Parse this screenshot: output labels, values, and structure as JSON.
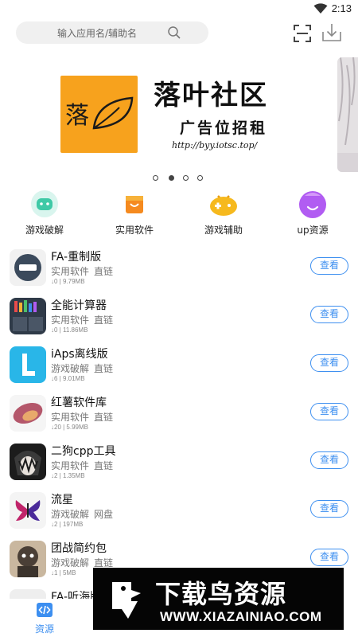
{
  "status": {
    "time": "2:13"
  },
  "search": {
    "placeholder": "输入应用名/辅助名"
  },
  "banner": {
    "logo_char": "落",
    "title": "落叶社区",
    "subtitle": "广告位招租",
    "url": "http://byy.iotsc.top/"
  },
  "categories": [
    {
      "label": "游戏破解",
      "icon": "gamepad-icon",
      "color": "#3ec9a6"
    },
    {
      "label": "实用软件",
      "icon": "shopping-bag-icon",
      "color": "#f58a1f"
    },
    {
      "label": "游戏辅助",
      "icon": "game-controller-icon",
      "color": "#f6b91e"
    },
    {
      "label": "up资源",
      "icon": "smile-blob-icon",
      "color": "#b15cf2"
    }
  ],
  "apps": [
    {
      "name": "FA-重制版",
      "category": "实用软件",
      "link": "直链",
      "stats": "↓0 | 9.79MB",
      "button": "查看"
    },
    {
      "name": "全能计算器",
      "category": "实用软件",
      "link": "直链",
      "stats": "↓0 | 11.86MB",
      "button": "查看"
    },
    {
      "name": "iAps离线版",
      "category": "游戏破解",
      "link": "直链",
      "stats": "↓6 | 9.01MB",
      "button": "查看"
    },
    {
      "name": "红薯软件库",
      "category": "实用软件",
      "link": "直链",
      "stats": "↓20 | 5.99MB",
      "button": "查看"
    },
    {
      "name": "二狗cpp工具",
      "category": "实用软件",
      "link": "直链",
      "stats": "↓2 | 1.35MB",
      "button": "查看"
    },
    {
      "name": "流星",
      "category": "游戏破解",
      "link": "网盘",
      "stats": "↓2 | 197MB",
      "button": "查看"
    },
    {
      "name": "团战简约包",
      "category": "游戏破解",
      "link": "直链",
      "stats": "↓1 | 5MB",
      "button": "查看"
    },
    {
      "name": "FA-听海版",
      "category": "",
      "link": "",
      "stats": "",
      "button": ""
    }
  ],
  "tabbar": {
    "home_label": "资源"
  },
  "watermark": {
    "title": "下载鸟资源",
    "url": "WWW.XIAZAINIAO.COM"
  },
  "colors": {
    "accent": "#3d8ff0",
    "logo_bg": "#f7a21d"
  }
}
